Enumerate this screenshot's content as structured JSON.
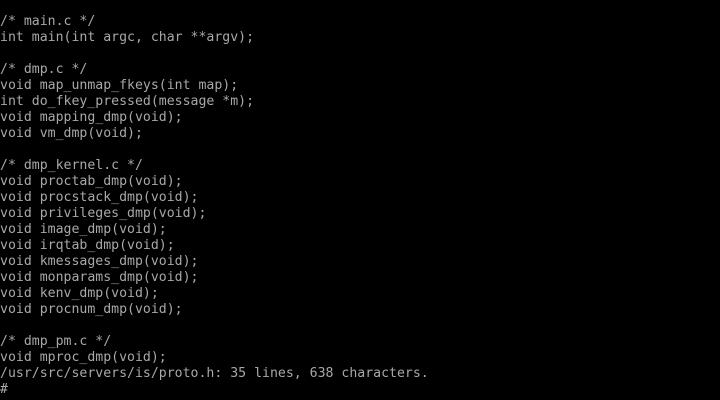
{
  "terminal": {
    "lines": [
      "/* main.c */",
      "int main(int argc, char **argv);",
      "",
      "/* dmp.c */",
      "void map_unmap_fkeys(int map);",
      "int do_fkey_pressed(message *m);",
      "void mapping_dmp(void);",
      "void vm_dmp(void);",
      "",
      "/* dmp_kernel.c */",
      "void proctab_dmp(void);",
      "void procstack_dmp(void);",
      "void privileges_dmp(void);",
      "void image_dmp(void);",
      "void irqtab_dmp(void);",
      "void kmessages_dmp(void);",
      "void monparams_dmp(void);",
      "void kenv_dmp(void);",
      "void procnum_dmp(void);",
      "",
      "/* dmp_pm.c */",
      "void mproc_dmp(void);"
    ],
    "status_line": "/usr/src/servers/is/proto.h: 35 lines, 638 characters.",
    "prompt": "#"
  },
  "colors": {
    "background": "#000000",
    "text": "#a8a8a8"
  }
}
